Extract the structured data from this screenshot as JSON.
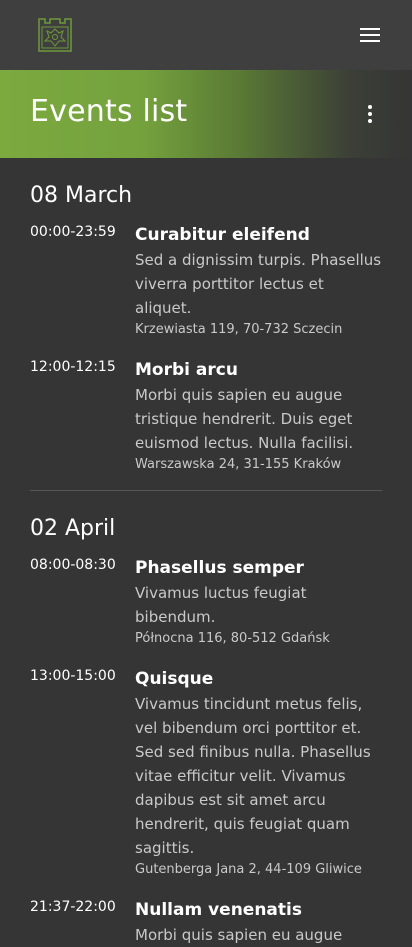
{
  "header": {
    "logo_icon": "castle-logo-icon",
    "menu_icon": "hamburger-menu-icon"
  },
  "hero": {
    "title": "Events list",
    "options_icon": "more-vertical-icon",
    "gradient_start": "#7caa3f"
  },
  "sections": [
    {
      "date": "08 March",
      "events": [
        {
          "time": "00:00-23:59",
          "title": "Curabitur eleifend",
          "description": "Sed a dignissim turpis. Phasellus viverra porttitor lectus et aliquet.",
          "address": "Krzewiasta 119, 70-732 Sczecin"
        },
        {
          "time": "12:00-12:15",
          "title": "Morbi arcu",
          "description": "Morbi quis sapien eu augue tristique hendrerit. Duis eget euismod lectus. Nulla facilisi.",
          "address": "Warszawska 24, 31-155 Kraków"
        }
      ]
    },
    {
      "date": "02 April",
      "events": [
        {
          "time": "08:00-08:30",
          "title": "Phasellus semper",
          "description": "Vivamus luctus feugiat bibendum.",
          "address": "Północna 116, 80-512 Gdańsk"
        },
        {
          "time": "13:00-15:00",
          "title": "Quisque",
          "description": "Vivamus tincidunt metus felis, vel bibendum orci porttitor et. Sed sed  finibus nulla. Phasellus vitae efficitur velit. Vivamus dapibus est sit  amet arcu hendrerit, quis feugiat quam sagittis.",
          "address": "Gutenberga Jana 2, 44-109 Gliwice"
        },
        {
          "time": "21:37-22:00",
          "title": "Nullam venenatis",
          "description": "Morbi quis sapien eu augue"
        }
      ]
    }
  ]
}
